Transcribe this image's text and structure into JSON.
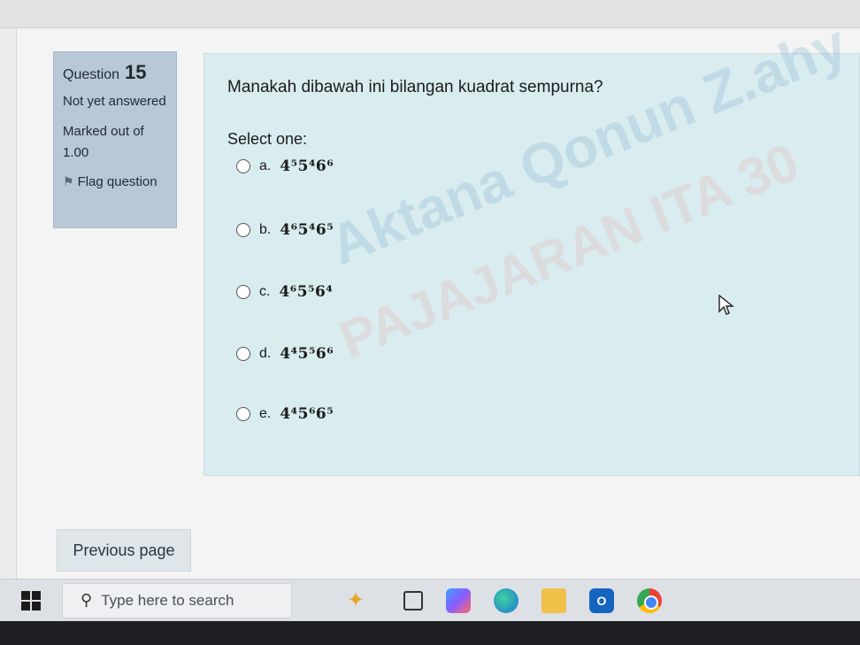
{
  "question": {
    "label": "Question",
    "number": "15",
    "state": "Not yet answered",
    "marked_out_of": "Marked out of",
    "mark_value": "1.00",
    "flag_label": "Flag question"
  },
  "content": {
    "question_text": "Manakah dibawah ini bilangan kuadrat sempurna?",
    "select_one": "Select one:",
    "options": [
      {
        "letter": "a.",
        "expr": "4⁵5⁴6⁶"
      },
      {
        "letter": "b.",
        "expr": "4⁶5⁴6⁵"
      },
      {
        "letter": "c.",
        "expr": "4⁶5⁵6⁴"
      },
      {
        "letter": "d.",
        "expr": "4⁴5⁵6⁶"
      },
      {
        "letter": "e.",
        "expr": "4⁴5⁶6⁵"
      }
    ],
    "watermark_line1": "Aktana Qonun Z.ahy",
    "watermark_line2": "PAJAJARAN ITA 30"
  },
  "nav": {
    "previous_label": "Previous page"
  },
  "taskbar": {
    "search_placeholder": "Type here to search"
  }
}
